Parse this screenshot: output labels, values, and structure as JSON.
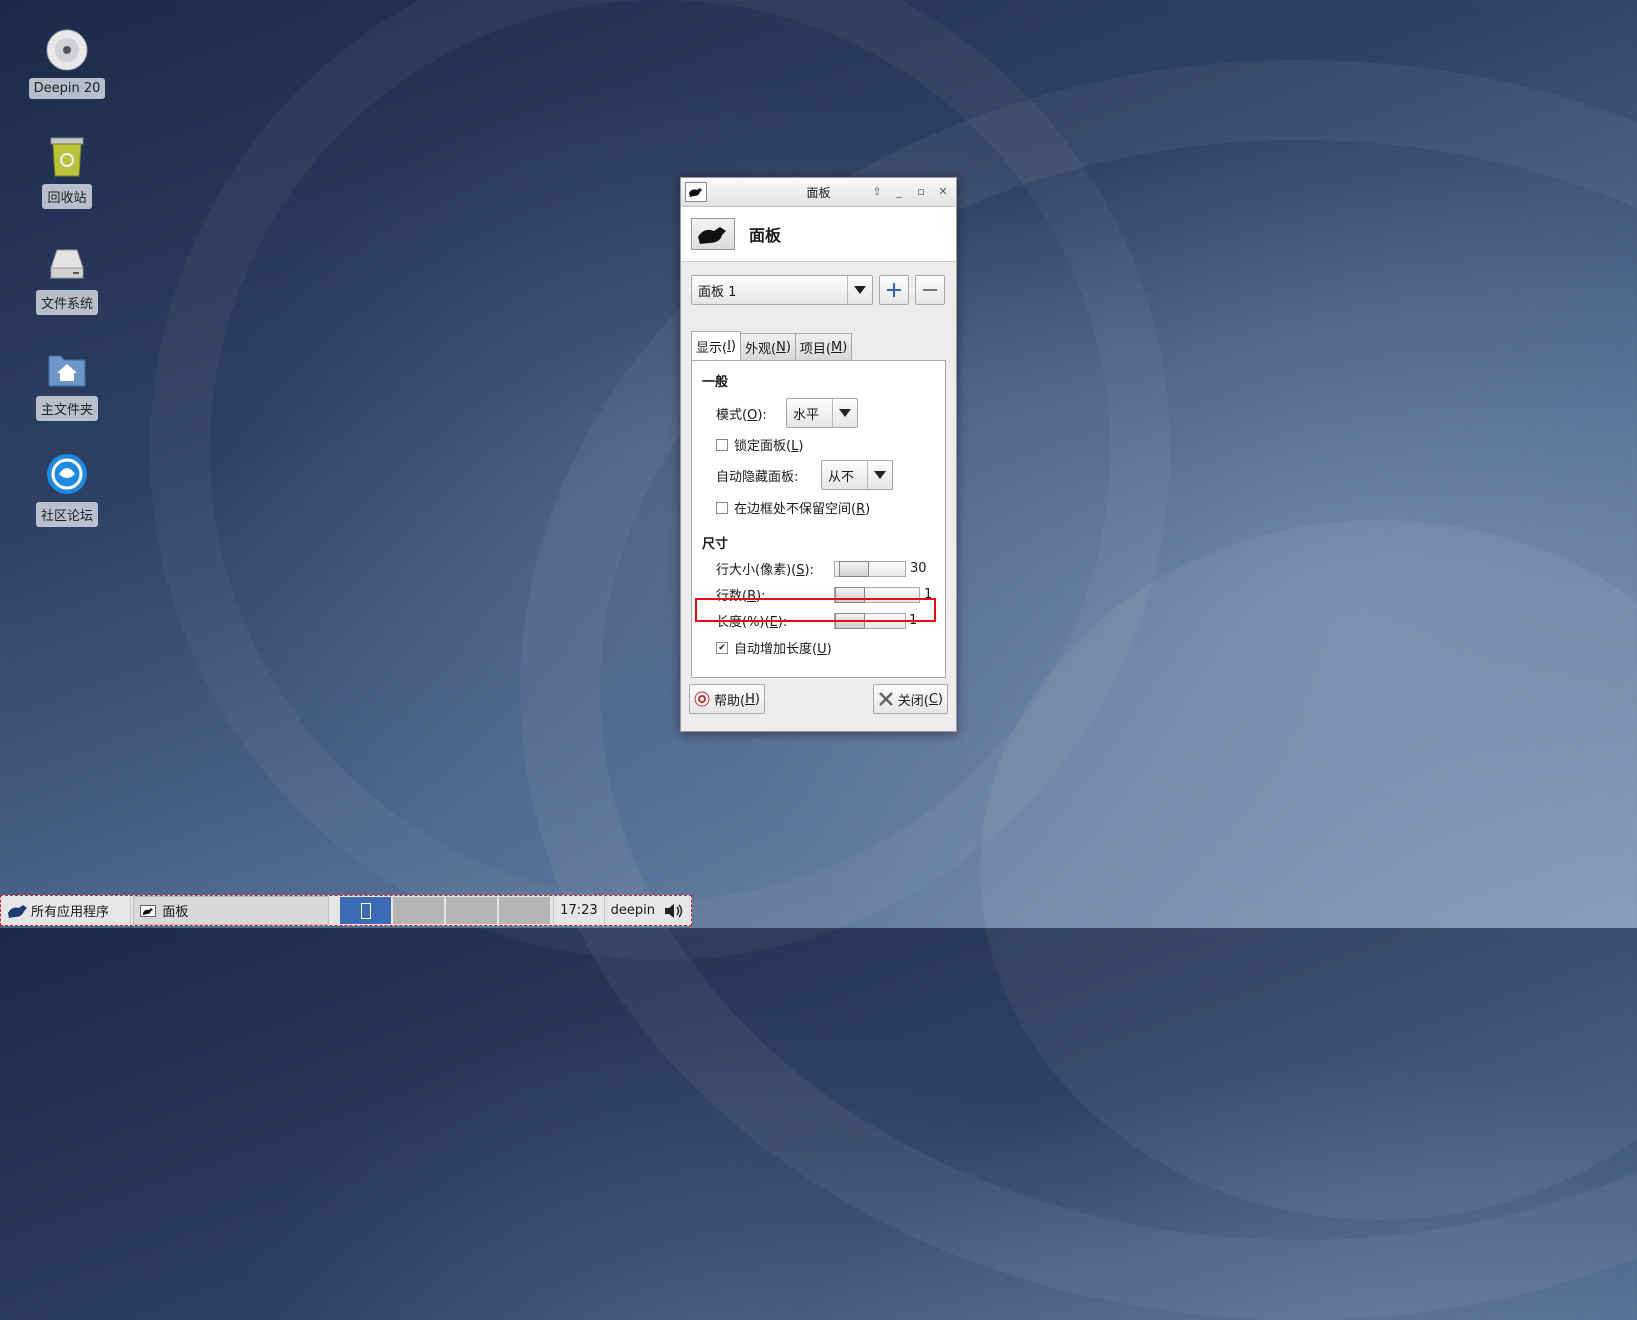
{
  "desktop": {
    "icons": [
      {
        "label": "Deepin 20",
        "icon": "disc-icon"
      },
      {
        "label": "回收站",
        "icon": "trash-icon"
      },
      {
        "label": "文件系统",
        "icon": "drive-icon"
      },
      {
        "label": "主文件夹",
        "icon": "home-folder-icon"
      },
      {
        "label": "社区论坛",
        "icon": "deepin-logo-icon"
      }
    ]
  },
  "window": {
    "title": "面板",
    "header_title": "面板",
    "panel_select": "面板 1",
    "tabs": [
      {
        "pre": "显示(",
        "key": "I",
        "post": ")"
      },
      {
        "pre": "外观(",
        "key": "N",
        "post": ")"
      },
      {
        "pre": "项目(",
        "key": "M",
        "post": ")"
      }
    ],
    "general": {
      "heading": "一般",
      "mode_label": {
        "pre": "模式(",
        "key": "O",
        "post": "):"
      },
      "mode_value": "水平",
      "lock_label": {
        "pre": "锁定面板(",
        "key": "L",
        "post": ")"
      },
      "lock_checked": false,
      "autohide_label": "自动隐藏面板:",
      "autohide_value": "从不",
      "reserve_label": {
        "pre": "在边框处不保留空间(",
        "key": "R",
        "post": ")"
      },
      "reserve_checked": false
    },
    "size": {
      "heading": "尺寸",
      "row_size_label": {
        "pre": "行大小(像素)(",
        "key": "S",
        "post": "):"
      },
      "row_size_value": "30",
      "rows_label": {
        "pre": "行数(",
        "key": "B",
        "post": "):"
      },
      "rows_value": "1",
      "length_label": {
        "pre": "长度(%)(",
        "key": "E",
        "post": "):"
      },
      "length_value": "1",
      "autogrow_label": {
        "pre": "自动增加长度(",
        "key": "U",
        "post": ")"
      },
      "autogrow_checked": true,
      "checkmark": "✔"
    },
    "help_button": {
      "pre": "帮助(",
      "key": "H",
      "post": ")"
    },
    "close_button": {
      "pre": "关闭(",
      "key": "C",
      "post": ")"
    }
  },
  "taskbar": {
    "menu_label": "所有应用程序",
    "task_label": "面板",
    "clock": "17:23",
    "user": "deepin"
  },
  "colors": {
    "highlight": "#e01010",
    "active_workspace": "#3d6bb3"
  }
}
